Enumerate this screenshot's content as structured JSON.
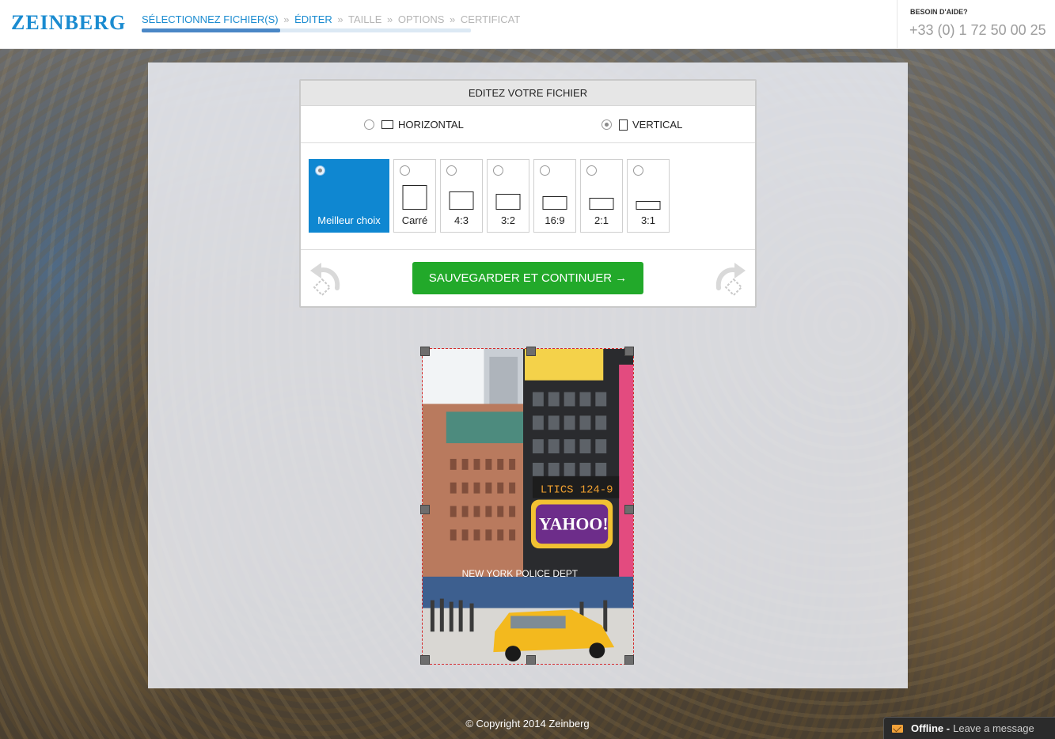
{
  "header": {
    "logo": "ZEINBERG",
    "steps": [
      {
        "label": "SÉLECTIONNEZ FICHIER(S)",
        "active": true
      },
      {
        "label": "ÉDITER",
        "active": true
      },
      {
        "label": "TAILLE",
        "active": false
      },
      {
        "label": "OPTIONS",
        "active": false
      },
      {
        "label": "CERTIFICAT",
        "active": false
      }
    ],
    "step_separator": "»",
    "progress_fraction": 0.42,
    "help_label": "BESOIN D'AIDE?",
    "phone": "+33 (0) 1 72 50 00 25"
  },
  "editor": {
    "title": "EDITEZ VOTRE FICHIER",
    "orientation": {
      "horizontal_label": "HORIZONTAL",
      "vertical_label": "VERTICAL",
      "selected": "vertical"
    },
    "ratios": [
      {
        "label": "Meilleur choix",
        "selected": true
      },
      {
        "label": "Carré",
        "selected": false
      },
      {
        "label": "4:3",
        "selected": false
      },
      {
        "label": "3:2",
        "selected": false
      },
      {
        "label": "16:9",
        "selected": false
      },
      {
        "label": "2:1",
        "selected": false
      },
      {
        "label": "3:1",
        "selected": false
      }
    ],
    "save_label": "SAUVEGARDER ET CONTINUER →"
  },
  "footer": {
    "copyright": "© Copyright 2014 Zeinberg",
    "chat_status": "Offline -",
    "chat_message": "Leave a message"
  },
  "colors": {
    "brand": "#1a8bd0",
    "save_button": "#22a92a",
    "selected_ratio": "#0f87d1",
    "crop_border": "#d42a2a"
  }
}
